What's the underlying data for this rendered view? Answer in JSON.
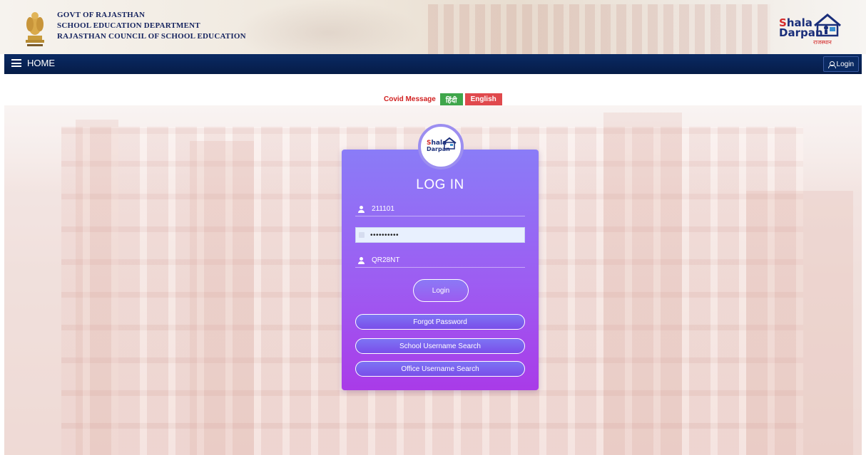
{
  "header": {
    "gov_line1": "GOVT OF RAJASTHAN",
    "gov_line2": "SCHOOL EDUCATION DEPARTMENT",
    "gov_line3": "RAJASTHAN COUNCIL OF SCHOOL EDUCATION",
    "brand_line1_a": "S",
    "brand_line1_b": "hala",
    "brand_line2": "Darpan",
    "brand_tagline": "राजस्थान"
  },
  "nav": {
    "home_label": "HOME",
    "login_label": "Login"
  },
  "covid": {
    "label": "Covid Message",
    "hindi_label": "हिंदी",
    "english_label": "English"
  },
  "login_card": {
    "title": "LOG IN",
    "username_value": "211101",
    "password_value": "••••••••••",
    "captcha_value": "QR28NT",
    "login_button": "Login",
    "forgot_password": "Forgot Password",
    "school_username_search": "School Username Search",
    "office_username_search": "Office Username Search"
  },
  "colors": {
    "navbar": "#0a2a63",
    "card_top": "#8a7cf7",
    "card_bottom": "#a93be8",
    "covid_red": "#d11f1f",
    "hindi_green": "#3fa64b",
    "english_red": "#e0494d"
  }
}
